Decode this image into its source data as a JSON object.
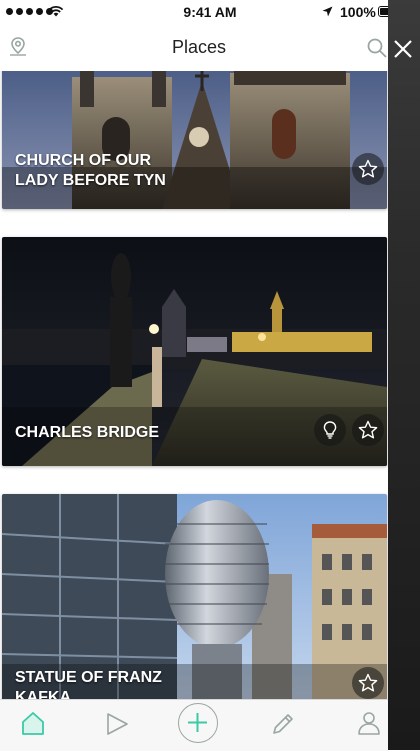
{
  "status_bar": {
    "time": "9:41 AM",
    "battery": "100%",
    "signal_dots": 5,
    "icons": [
      "signal-dots",
      "wifi-icon",
      "location-arrow-icon",
      "battery-icon"
    ]
  },
  "nav": {
    "title": "Places",
    "left_icon": "map-pin-icon",
    "right_icon": "search-icon"
  },
  "places": [
    {
      "name": "CHURCH OF OUR\nLADY BEFORE TYN",
      "favorite_icon": "star-icon"
    },
    {
      "name": "CHARLES BRIDGE",
      "audio_icon": "lightbulb-icon",
      "favorite_icon": "star-icon"
    },
    {
      "name": "STATUE OF FRANZ\nKAFKA",
      "favorite_icon": "star-icon"
    }
  ],
  "tab_bar": {
    "items": [
      "home-tab",
      "play-tab",
      "add-tab",
      "edit-tab",
      "profile-tab"
    ],
    "active": "home-tab",
    "accent_color": "#3cc9a6"
  },
  "side_panel": {
    "close_icon": "close-icon"
  }
}
